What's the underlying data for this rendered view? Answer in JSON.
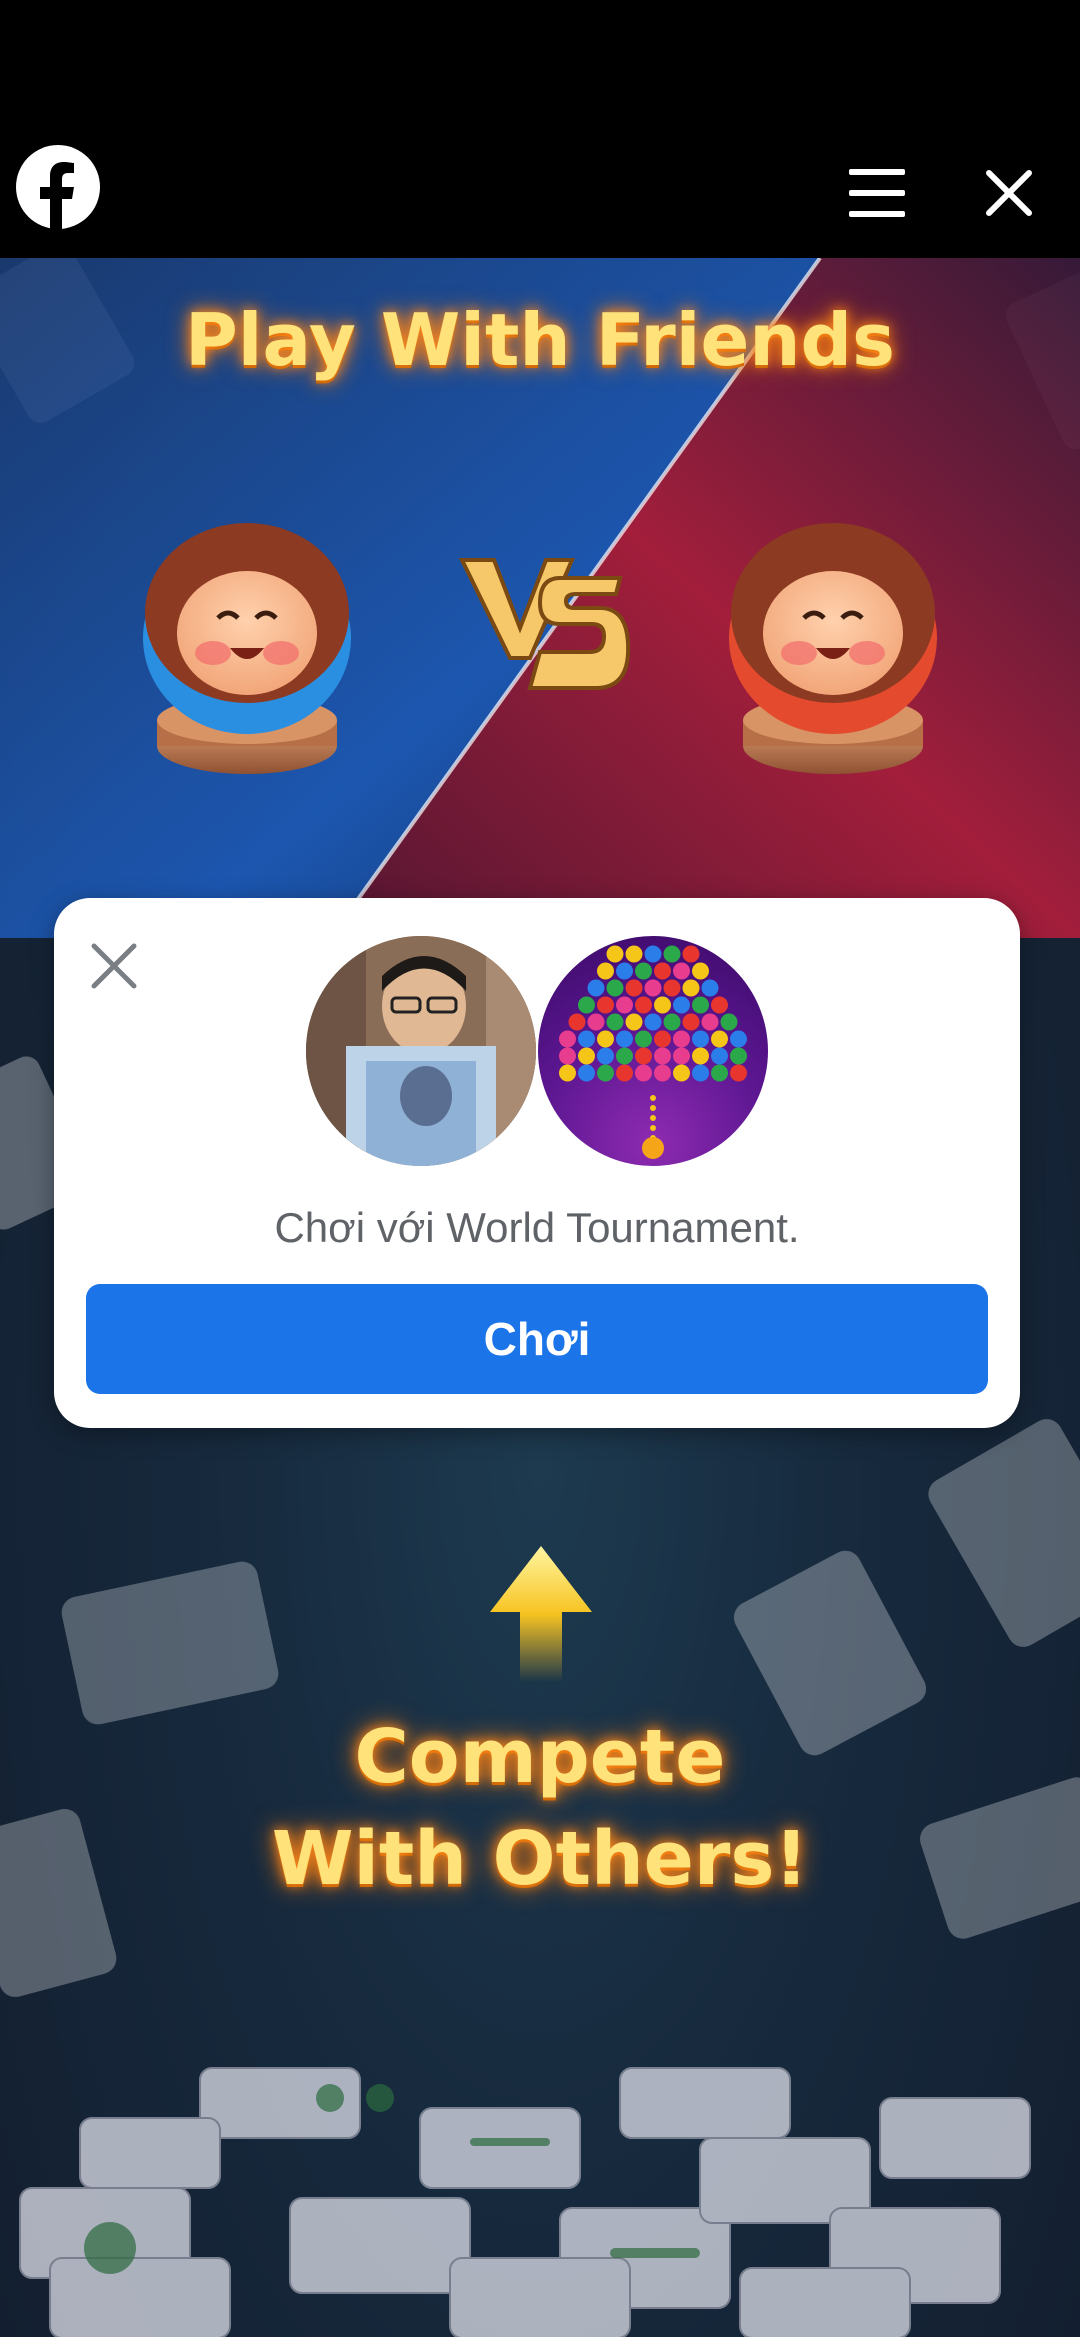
{
  "header": {
    "logo_icon": "facebook-logo-icon",
    "menu_icon": "hamburger-menu-icon",
    "close_icon": "close-icon"
  },
  "game": {
    "title": "Play With Friends",
    "vs_label": "VS",
    "compete_line1": "Compete",
    "compete_line2": "With Others!"
  },
  "dialog": {
    "message": "Chơi với World Tournament.",
    "play_label": "Chơi",
    "close_icon": "close-icon"
  },
  "colors": {
    "play_button": "#1b74e8",
    "title_gold": "#ffe27a",
    "blue_side": "#1f6fd6",
    "red_side": "#d42340"
  }
}
